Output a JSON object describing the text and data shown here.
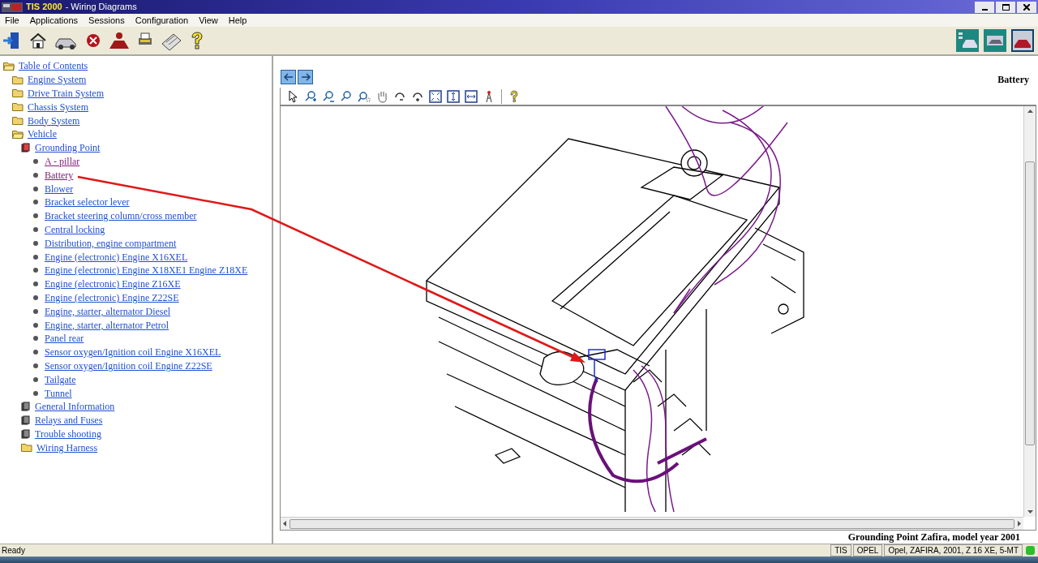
{
  "window": {
    "app_name": "TIS 2000",
    "title": "- Wiring Diagrams"
  },
  "menu": [
    "File",
    "Applications",
    "Sessions",
    "Configuration",
    "View",
    "Help"
  ],
  "tree": {
    "label": "Table of Contents",
    "kind": "folder",
    "expanded": true,
    "visited": false,
    "children": [
      {
        "label": "Engine System",
        "kind": "folder",
        "expanded": false,
        "visited": false
      },
      {
        "label": "Drive Train System",
        "kind": "folder",
        "expanded": false,
        "visited": false
      },
      {
        "label": "Chassis System",
        "kind": "folder",
        "expanded": false,
        "visited": false
      },
      {
        "label": "Body System",
        "kind": "folder",
        "expanded": false,
        "visited": false
      },
      {
        "label": "Vehicle",
        "kind": "folder",
        "expanded": true,
        "visited": false,
        "children": [
          {
            "label": "Grounding Point",
            "kind": "book",
            "expanded": true,
            "visited": false,
            "children": [
              {
                "label": "A - pillar",
                "kind": "page",
                "visited": true
              },
              {
                "label": "Battery",
                "kind": "page",
                "visited": true
              },
              {
                "label": "Blower",
                "kind": "page",
                "visited": false
              },
              {
                "label": "Bracket selector lever",
                "kind": "page",
                "visited": false
              },
              {
                "label": "Bracket steering column/cross member",
                "kind": "page",
                "visited": false
              },
              {
                "label": "Central locking",
                "kind": "page",
                "visited": false
              },
              {
                "label": "Distribution, engine compartment",
                "kind": "page",
                "visited": false
              },
              {
                "label": "Engine (electronic) Engine X16XEL",
                "kind": "page",
                "visited": false
              },
              {
                "label": "Engine (electronic) Engine X18XE1 Engine Z18XE",
                "kind": "page",
                "visited": false
              },
              {
                "label": "Engine (electronic) Engine Z16XE",
                "kind": "page",
                "visited": false
              },
              {
                "label": "Engine (electronic) Engine Z22SE",
                "kind": "page",
                "visited": false
              },
              {
                "label": "Engine, starter, alternator Diesel",
                "kind": "page",
                "visited": false
              },
              {
                "label": "Engine, starter, alternator Petrol",
                "kind": "page",
                "visited": false
              },
              {
                "label": "Panel rear",
                "kind": "page",
                "visited": false
              },
              {
                "label": "Sensor oxygen/Ignition coil Engine X16XEL",
                "kind": "page",
                "visited": false
              },
              {
                "label": "Sensor oxygen/Ignition coil Engine Z22SE",
                "kind": "page",
                "visited": false
              },
              {
                "label": "Tailgate",
                "kind": "page",
                "visited": false
              },
              {
                "label": "Tunnel",
                "kind": "page",
                "visited": false
              }
            ]
          },
          {
            "label": "General Information",
            "kind": "book",
            "expanded": false,
            "visited": false
          },
          {
            "label": "Relays and Fuses",
            "kind": "book",
            "expanded": false,
            "visited": false
          },
          {
            "label": "Trouble shooting",
            "kind": "book",
            "expanded": false,
            "visited": false
          },
          {
            "label": "Wiring Harness",
            "kind": "folder",
            "expanded": false,
            "visited": false
          }
        ]
      }
    ]
  },
  "viewer": {
    "title": "Battery",
    "caption": "Grounding Point Zafira, model year 2001"
  },
  "status_bar": {
    "message": "Ready",
    "fields": [
      "TIS",
      "OPEL",
      "Opel, ZAFIRA, 2001, Z 16 XE, 5-MT"
    ],
    "online": true
  }
}
